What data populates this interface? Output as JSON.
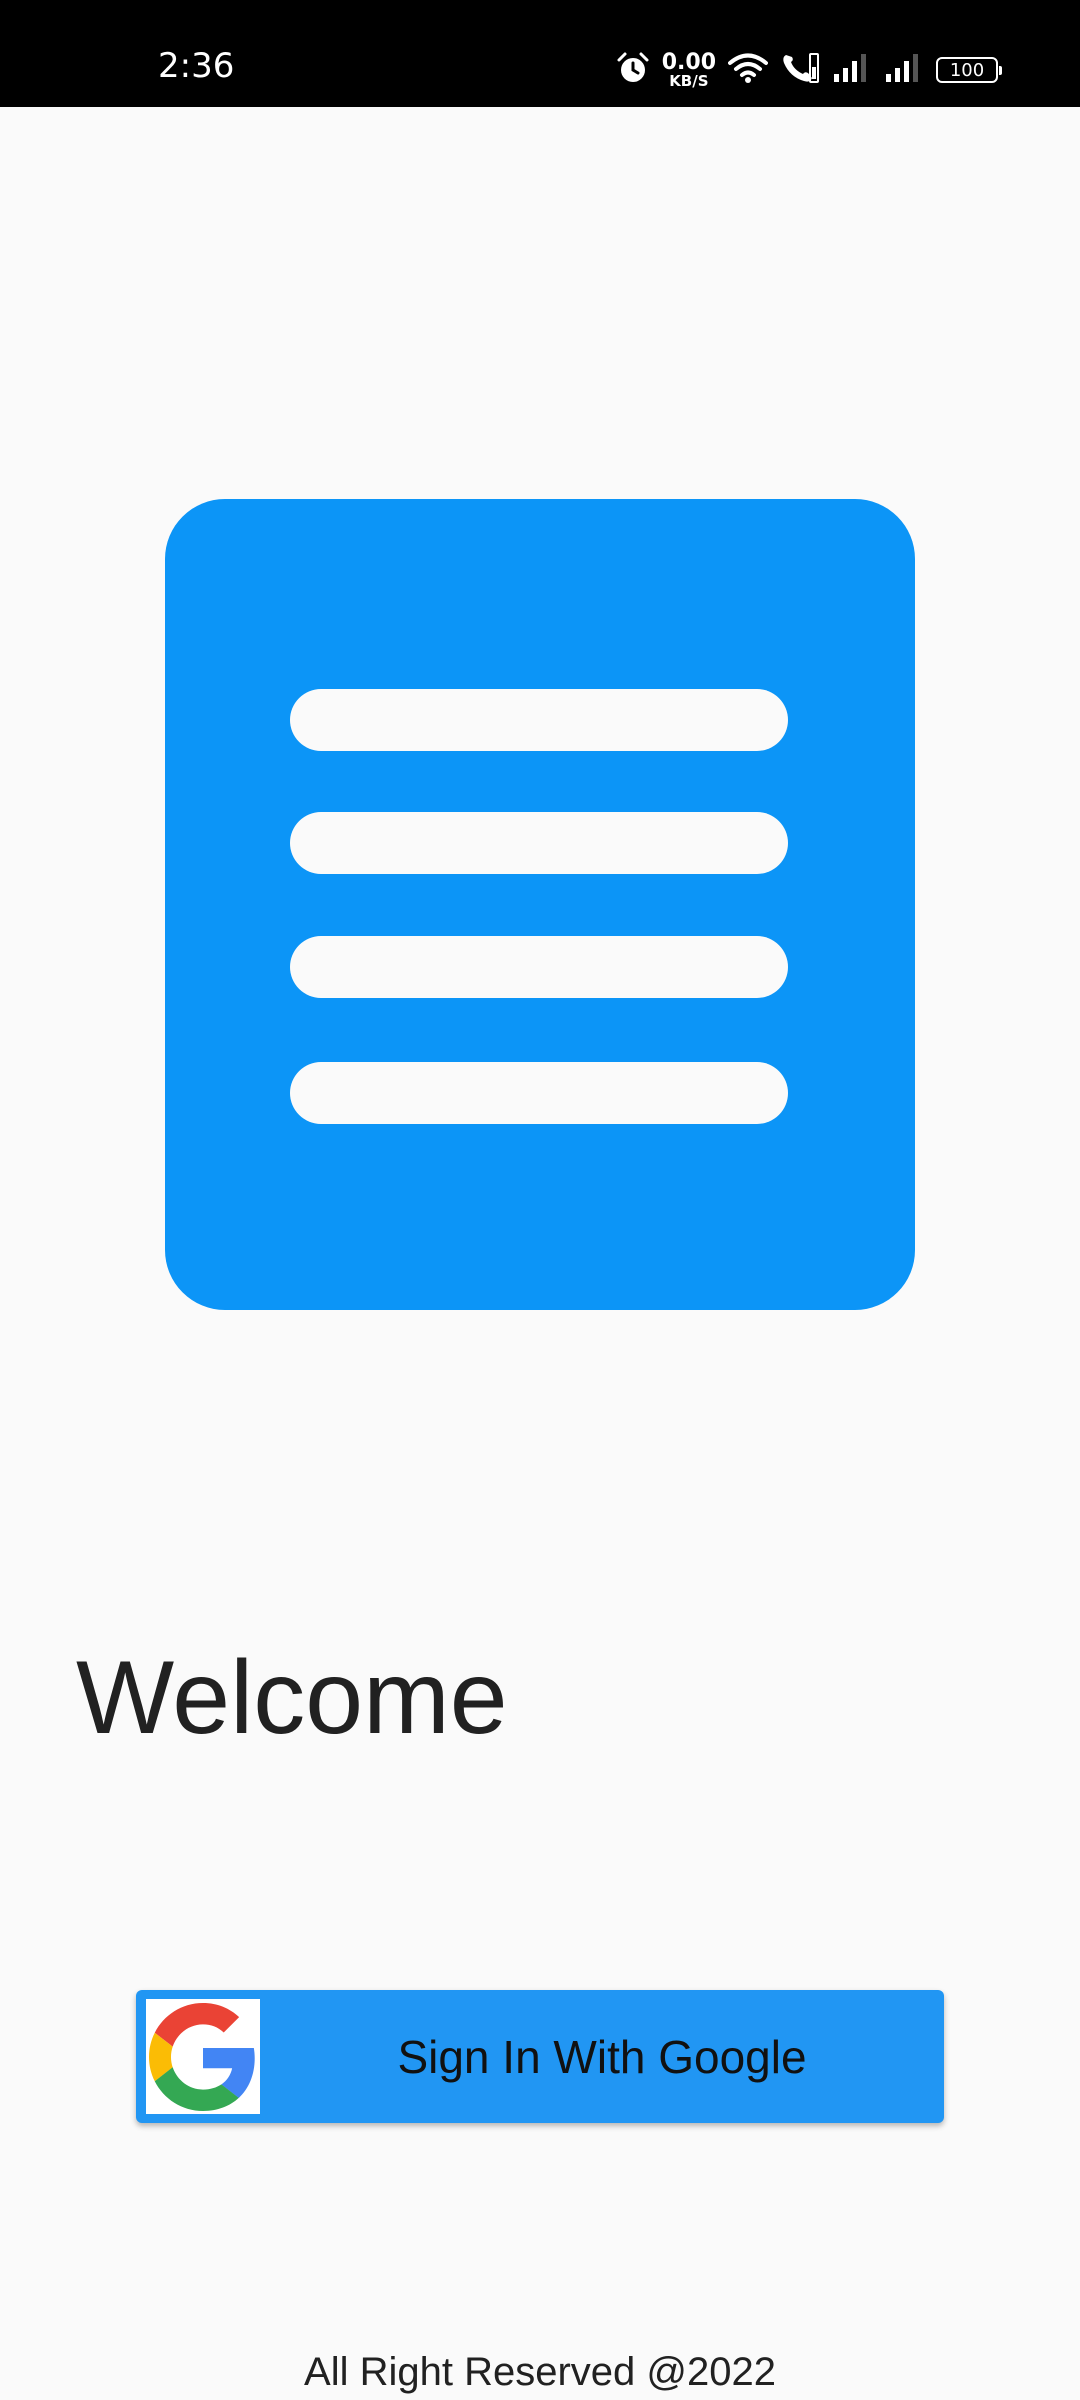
{
  "status_bar": {
    "time": "2:36",
    "net_speed_value": "0.00",
    "net_speed_unit": "KB/S",
    "battery": "100",
    "icons": [
      "alarm-icon",
      "wifi-icon",
      "wifi-call-icon",
      "signal-icon",
      "signal-icon"
    ]
  },
  "illustration": {
    "icon": "notepad-icon",
    "color": "#0c95f7",
    "line_color": "#fafafa"
  },
  "welcome": {
    "title": "Welcome"
  },
  "sign_in_button": {
    "label": "Sign In With Google",
    "icon": "google-logo-icon",
    "background": "#2196f3"
  },
  "footer": {
    "text": "All Right Reserved @2022"
  }
}
